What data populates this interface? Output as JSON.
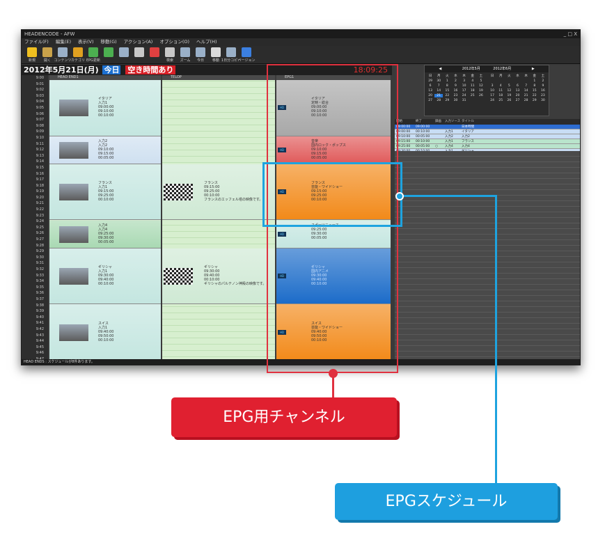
{
  "app": {
    "title": "HEADENCODE - AFW",
    "window_buttons": "_ □ X",
    "menu": [
      "ファイル(F)",
      "編集(E)",
      "表示(V)",
      "移動(G)",
      "アクション(A)",
      "オプション(O)",
      "ヘルプ(H)"
    ],
    "toolbar": [
      {
        "label": "新規",
        "icon": "sun-icon",
        "color": "#f0c020"
      },
      {
        "label": "開く",
        "icon": "folder-icon",
        "color": "#c9a24a"
      },
      {
        "label": "コンテンツ",
        "icon": "film-icon",
        "color": "#9ab0c8"
      },
      {
        "label": "カテゴリ",
        "icon": "book-icon",
        "color": "#e0a020"
      },
      {
        "label": "EPG更新",
        "icon": "refresh-icon",
        "color": "#4caf50"
      },
      {
        "label": "",
        "icon": "check-icon",
        "color": "#4caf50"
      },
      {
        "label": "",
        "icon": "copy-icon",
        "color": "#9ab0c8"
      },
      {
        "label": "",
        "icon": "page-icon",
        "color": "#c8c8c8"
      },
      {
        "label": "",
        "icon": "delete-icon",
        "color": "#e04040"
      },
      {
        "label": "検索",
        "icon": "binoculars-icon",
        "color": "#c8c8c8"
      },
      {
        "label": "ズーム",
        "icon": "zoom-icon",
        "color": "#9ab0c8"
      },
      {
        "label": "今日",
        "icon": "calendar-icon",
        "color": "#9ab0c8"
      },
      {
        "label": "移動",
        "icon": "clock-icon",
        "color": "#dadada"
      },
      {
        "label": "1日分コピー",
        "icon": "monitor-icon",
        "color": "#9ab0c8"
      },
      {
        "label": "バージョン",
        "icon": "help-icon",
        "color": "#3b7fe0"
      }
    ],
    "datebar": {
      "date": "2012年5月21日(月)",
      "today": "今日",
      "free_time": "空き時間あり",
      "clock": "18:09:25"
    },
    "status": "HEAD ENDS : スケジュールが8件あります。"
  },
  "timeline": [
    "9:00",
    "9:01",
    "9:02",
    "9:03",
    "9:04",
    "9:05",
    "9:06",
    "9:07",
    "9:08",
    "9:09",
    "9:10",
    "9:11",
    "9:12",
    "9:13",
    "9:14",
    "9:15",
    "9:16",
    "9:17",
    "9:18",
    "9:19",
    "9:20",
    "9:21",
    "9:22",
    "9:23",
    "9:24",
    "9:25",
    "9:26",
    "9:27",
    "9:28",
    "9:29",
    "9:30",
    "9:31",
    "9:32",
    "9:33",
    "9:34",
    "9:35",
    "9:36",
    "9:37",
    "9:38",
    "9:39",
    "9:40",
    "9:41",
    "9:42",
    "9:43",
    "9:44",
    "9:45",
    "9:46",
    "9:47",
    "9:48"
  ],
  "channels": [
    {
      "name": "HEAD END1",
      "programs": [
        {
          "title": "イタリア",
          "src": "入力1",
          "start": "09:00:00",
          "end": "09:10:00",
          "dur": "00:10:00",
          "color": "#c4e6e0"
        },
        {
          "title": "入力2",
          "src": "入力2",
          "start": "09:10:00",
          "end": "09:15:00",
          "dur": "00:05:00",
          "color": "#cfe0f0"
        },
        {
          "title": "フランス",
          "src": "入力1",
          "start": "09:15:00",
          "end": "09:25:00",
          "dur": "00:10:00",
          "color": "#c4e6e0"
        },
        {
          "title": "入力4",
          "src": "入力4",
          "start": "09:25:00",
          "end": "09:30:00",
          "dur": "00:05:00",
          "color": "#a9d9b3"
        },
        {
          "title": "ギリシャ",
          "src": "入力1",
          "start": "09:30:00",
          "end": "09:40:00",
          "dur": "00:10:00",
          "color": "#c4e6e0"
        },
        {
          "title": "スイス",
          "src": "入力1",
          "start": "09:40:00",
          "end": "09:50:00",
          "dur": "00:10:00",
          "color": "#c4e6e0"
        }
      ]
    },
    {
      "name": "TELOP",
      "programs": [
        {
          "title": "フランス",
          "text": "フランスのエッフェル塔の映像です。",
          "start": "09:15:00",
          "end": "09:25:00",
          "dur": "00:10:00",
          "color": "#cfe9d4"
        },
        {
          "title": "ギリシャ",
          "text": "ギリシャのパルテノン神殿の映像です。",
          "start": "09:30:00",
          "end": "09:40:00",
          "dur": "00:10:00",
          "color": "#cfe9d4"
        }
      ]
    },
    {
      "name": "EPG1",
      "programs": [
        {
          "title": "イタリア",
          "genre": "定時・総合",
          "start": "09:00:00",
          "end": "09:10:00",
          "dur": "00:10:00",
          "color": "#a8a8a8"
        },
        {
          "title": "音楽",
          "genre": "国内ロック・ポップス",
          "start": "09:10:00",
          "end": "09:15:00",
          "dur": "00:05:00",
          "color": "#e05a5a"
        },
        {
          "title": "フランス",
          "genre": "芸能・ワイドショー",
          "start": "09:15:00",
          "end": "09:25:00",
          "dur": "00:10:00",
          "color": "#f28a1a"
        },
        {
          "title": "スポーツニュース",
          "genre": "",
          "start": "09:25:00",
          "end": "09:30:00",
          "dur": "00:05:00",
          "color": "#c4e6e0"
        },
        {
          "title": "ギリシャ",
          "genre": "国内アニメ",
          "start": "09:30:00",
          "end": "09:40:00",
          "dur": "00:10:00",
          "color": "#1c6cc9"
        },
        {
          "title": "スイス",
          "genre": "芸能・ワイドショー",
          "start": "09:40:00",
          "end": "09:50:00",
          "dur": "00:10:00",
          "color": "#f28a1a"
        }
      ]
    }
  ],
  "calendar": {
    "month1": "2012年5月",
    "month2": "2012年6月",
    "weekdays": [
      "日",
      "月",
      "火",
      "水",
      "木",
      "金",
      "土"
    ],
    "days1": [
      "29",
      "30",
      "1",
      "2",
      "3",
      "4",
      "5",
      "6",
      "7",
      "8",
      "9",
      "10",
      "11",
      "12",
      "13",
      "14",
      "15",
      "16",
      "17",
      "18",
      "19",
      "20",
      "21",
      "22",
      "23",
      "24",
      "25",
      "26",
      "27",
      "28",
      "29",
      "30",
      "31"
    ],
    "days2": [
      "",
      "",
      "",
      "",
      "",
      "1",
      "2",
      "3",
      "4",
      "5",
      "6",
      "7",
      "8",
      "9",
      "10",
      "11",
      "12",
      "13",
      "14",
      "15",
      "16",
      "17",
      "18",
      "19",
      "20",
      "21",
      "22",
      "23",
      "24",
      "25",
      "26",
      "27",
      "28",
      "29",
      "30"
    ]
  },
  "schedule": {
    "headers": [
      "開始",
      "終了",
      "録画",
      "入力ソース",
      "タイトル"
    ],
    "rows": [
      {
        "start": "09:00:00",
        "end": "09:00:00",
        "rec": "",
        "src": "",
        "title": "日本時間",
        "color": "#2d6cd0"
      },
      {
        "start": "09:00:00",
        "end": "00:10:00",
        "rec": "",
        "src": "入力1",
        "title": "イタリア",
        "color": "#c8ddf4"
      },
      {
        "start": "09:10:00",
        "end": "00:05:00",
        "rec": "",
        "src": "入力2",
        "title": "入力2",
        "color": "#c8ddf4"
      },
      {
        "start": "09:15:00",
        "end": "00:10:00",
        "rec": "",
        "src": "入力1",
        "title": "フランス",
        "color": "#b9e4cc"
      },
      {
        "start": "09:25:00",
        "end": "00:05:00",
        "rec": "○",
        "src": "入力4",
        "title": "入力4",
        "color": "#b9e4cc"
      },
      {
        "start": "09:30:00",
        "end": "00:10:00",
        "rec": "",
        "src": "入力1",
        "title": "ギリシャ",
        "color": "#c8ddf4"
      },
      {
        "start": "09:40:00",
        "end": "00:10:00",
        "rec": "",
        "src": "入力1",
        "title": "スイス",
        "color": "#c8ddf4"
      },
      {
        "start": "",
        "end": "",
        "rec": "",
        "src": "",
        "title": "日本時間",
        "color": "#e02030"
      }
    ]
  },
  "callouts": {
    "epg_channel": "EPG用チャンネル",
    "epg_schedule": "EPGスケジュール"
  }
}
